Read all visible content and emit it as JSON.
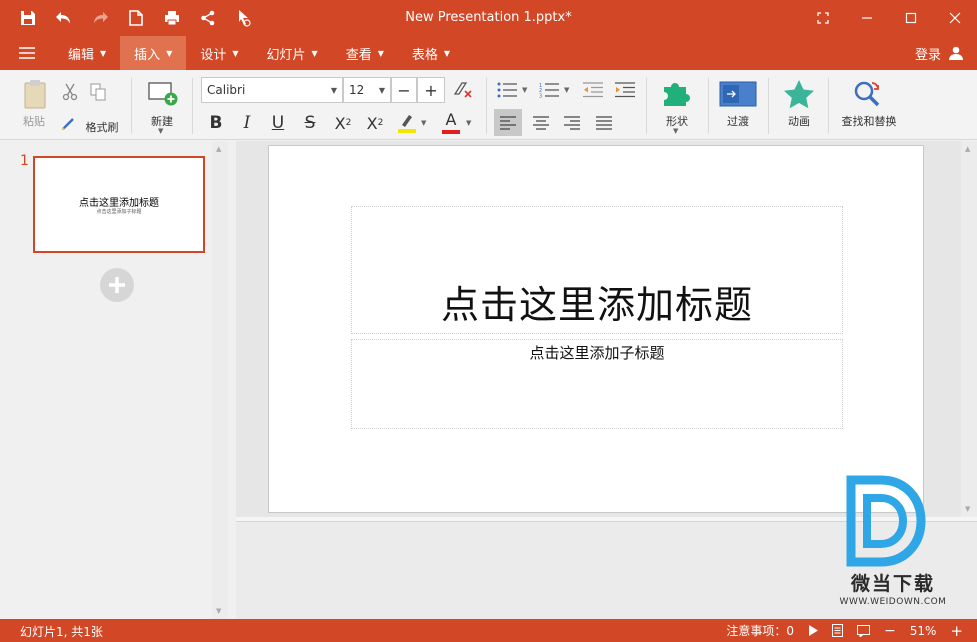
{
  "window": {
    "title": "New Presentation 1.pptx*"
  },
  "menu": {
    "items": [
      {
        "label": "编辑",
        "has_caret": true,
        "active": false
      },
      {
        "label": "插入",
        "has_caret": true,
        "active": true
      },
      {
        "label": "设计",
        "has_caret": true,
        "active": false
      },
      {
        "label": "幻灯片",
        "has_caret": true,
        "active": false
      },
      {
        "label": "查看",
        "has_caret": true,
        "active": false
      },
      {
        "label": "表格",
        "has_caret": true,
        "active": false
      }
    ],
    "login_label": "登录"
  },
  "ribbon": {
    "paste_label": "粘贴",
    "format_painter_label": "格式刷",
    "new_label": "新建",
    "font_name": "Calibri",
    "font_size": "12",
    "shapes_label": "形状",
    "transition_label": "过渡",
    "animation_label": "动画",
    "find_replace_label": "查找和替换"
  },
  "slides_panel": {
    "number": "1",
    "thumb_title": "点击这里添加标题",
    "thumb_subtitle": "点击这里添加子标题"
  },
  "slide": {
    "title_placeholder": "点击这里添加标题",
    "subtitle_placeholder": "点击这里添加子标题"
  },
  "watermark": {
    "text": "微当下载",
    "url": "WWW.WEIDOWN.COM"
  },
  "status": {
    "slide_info": "幻灯片1, 共1张",
    "notes_label": "注意事项：0",
    "zoom": "51%"
  },
  "colors": {
    "accent": "#d24726",
    "active_menu": "#e0724f"
  }
}
